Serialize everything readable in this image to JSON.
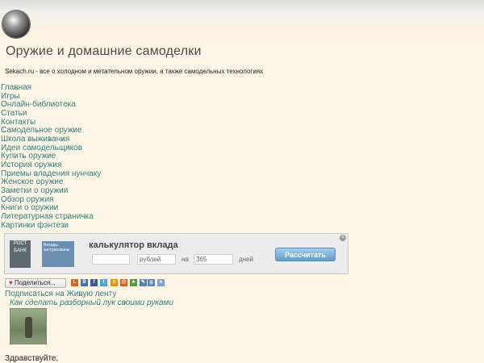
{
  "header": {
    "title": "Оружие и домашние самоделки",
    "tagline": "Sekach.ru - все о холодном и метательном оружии, а также самодельных технологиях"
  },
  "nav": {
    "items": [
      "Главная",
      "Игры",
      "Онлайн-библиотека",
      "Статьи",
      "Контакты",
      "Самодельное оружие",
      "Школа выживания",
      "Идеи самодельщиков",
      "Купить оружие",
      "История оружия",
      "Приемы владения нунчаку",
      "Женское оружие",
      "Заметки о оружии",
      "Обзор оружия",
      "Книги о оружии",
      "Литературная страничка",
      "Картинки фэнтези"
    ]
  },
  "ad": {
    "brand": "РОСТ БАНК",
    "deposit_text": "Вклады застрахованы",
    "heading": "калькулятор вклада",
    "currency_label": "рублей",
    "on_label": "на",
    "days_value": "365",
    "days_label": "дней",
    "button": "Рассчитать",
    "close": "×"
  },
  "share": {
    "button_label": "Поделиться...",
    "icons": [
      "liveinternet-icon",
      "vk-icon",
      "facebook-icon",
      "twitter-icon",
      "odnoklassniki-icon",
      "moimir-icon",
      "delicious-icon",
      "livejournal-icon",
      "google-icon",
      "yandex-icon"
    ]
  },
  "subscribe_label": "Подписаться на Живую ленту",
  "post": {
    "title": "Как сделать разборный лук своими руками",
    "greeting": "Здравствуйте,"
  },
  "colors": {
    "link": "#2f7f7f",
    "background": "#fdf6e6"
  }
}
